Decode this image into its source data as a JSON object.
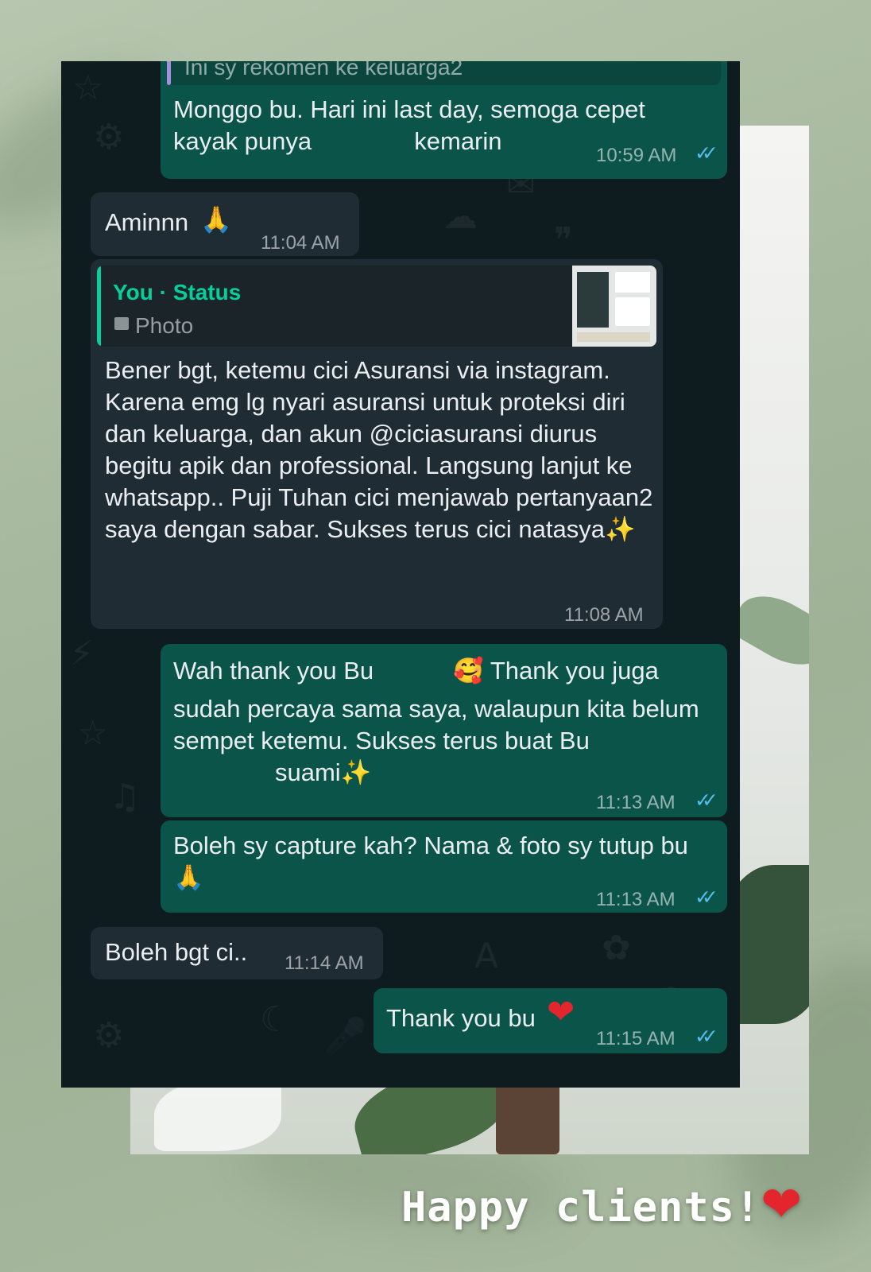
{
  "messages": {
    "m1": {
      "quote_text": "Ini sy rekomen ke keluarga2",
      "text": "Monggo bu. Hari ini last day, semoga cepet kayak punya               kemarin",
      "time": "10:59 AM",
      "status": "read"
    },
    "m2": {
      "text": "Aminnn",
      "emoji": "🙏",
      "time": "11:04 AM"
    },
    "m3": {
      "quote_author": "You · Status",
      "quote_type": "Photo",
      "text": "Bener bgt, ketemu cici Asuransi via instagram. Karena emg lg nyari asuransi untuk proteksi diri dan keluarga, dan akun @ciciasuransi diurus begitu apik dan professional. Langsung lanjut ke whatsapp.. Puji Tuhan cici menjawab pertanyaan2 saya dengan sabar. Sukses terus cici natasya",
      "emoji": "✨",
      "time": "11:08 AM"
    },
    "m4": {
      "line1_a": "Wah thank you Bu",
      "emoji1": "🥰",
      "line1_b": "Thank you juga",
      "rest": "sudah percaya sama saya, walaupun kita belum sempet ketemu. Sukses terus buat Bu",
      "line_last": "suami",
      "emoji2": "✨",
      "time": "11:13 AM",
      "status": "read"
    },
    "m5": {
      "text": "Boleh sy capture kah? Nama & foto sy tutup bu",
      "emoji": "🙏",
      "time": "11:13 AM",
      "status": "read"
    },
    "m6": {
      "text": "Boleh bgt ci..",
      "time": "11:14 AM"
    },
    "m7": {
      "text": "Thank you bu",
      "emoji": "❤",
      "time": "11:15 AM",
      "status": "read"
    }
  },
  "caption": {
    "text": "Happy clients!",
    "emoji": "❤"
  },
  "colors": {
    "chat_bg": "#0f1c1f",
    "outgoing_bubble": "#0b544a",
    "incoming_bubble": "#202c33",
    "read_ticks": "#53bdeb",
    "quote_accent": "#06cf9c",
    "story_bg": "#a7b99f"
  },
  "icons": {
    "read_status": "double-check-icon",
    "photo": "photo-icon"
  }
}
